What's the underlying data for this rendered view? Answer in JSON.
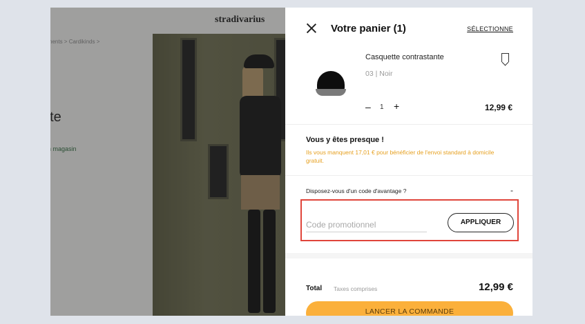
{
  "background_page": {
    "breadcrumb": "nents > Cardikinds >",
    "title_fragment": "nte",
    "store_link": "n magasin",
    "logo": "stradivarius"
  },
  "cart": {
    "title": "Votre panier (1)",
    "select_label": "SÉLECTIONNE",
    "item": {
      "name": "Casquette contrastante",
      "variant": "03  |  Noir",
      "quantity": "1",
      "minus": "–",
      "plus": "+",
      "price": "12,99 €"
    },
    "shipping": {
      "title": "Vous y êtes presque !",
      "message": "Ils vous manquent 17,01 €  pour bénéficier de l'envoi standard à domicile gratuit."
    },
    "promo": {
      "question": "Disposez-vous d'un code d'avantage ?",
      "toggle": "-",
      "placeholder": "Code promotionnel",
      "apply_label": "APPLIQUER"
    },
    "total": {
      "label": "Total",
      "tax_note": "Taxes comprises",
      "amount": "12,99 €"
    },
    "checkout_label": "LANCER LA COMMANDE"
  },
  "colors": {
    "accent": "#fbb03b",
    "shipping_message": "#e6a020",
    "highlight_border": "#e0443a"
  }
}
